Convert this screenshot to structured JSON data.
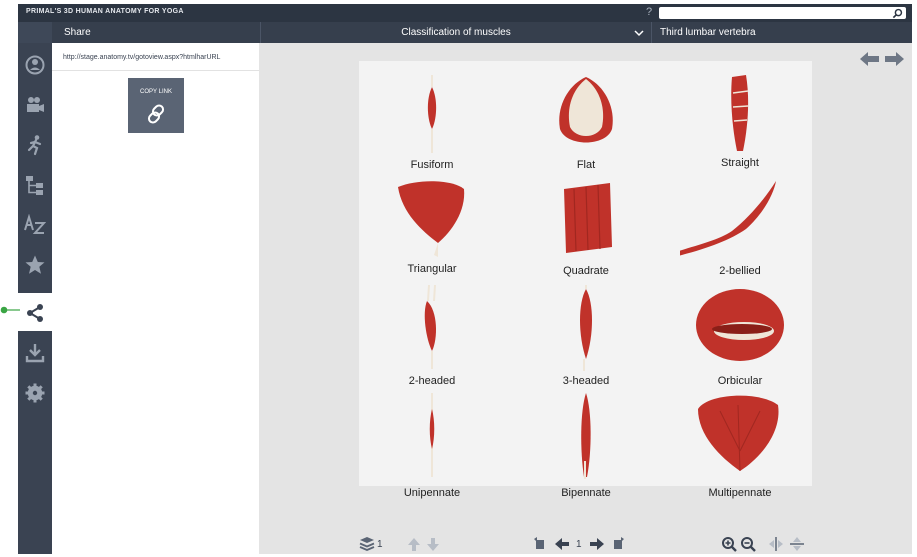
{
  "app": {
    "title": "PRIMAL'S 3D HUMAN ANATOMY FOR YOGA",
    "help": "?"
  },
  "search": {
    "placeholder": ""
  },
  "header": {
    "share": "Share",
    "classification": "Classification of muscles",
    "lumbar": "Third lumbar vertebra"
  },
  "sidebar": {
    "items": [
      {
        "icon": "atlas-icon"
      },
      {
        "icon": "video-camera-icon"
      },
      {
        "icon": "running-figure-icon"
      },
      {
        "icon": "hierarchy-tree-icon"
      },
      {
        "icon": "a-to-z-icon"
      },
      {
        "icon": "star-icon"
      },
      {
        "icon": "share-icon",
        "active": true
      },
      {
        "icon": "download-icon"
      },
      {
        "icon": "settings-gear-icon"
      }
    ]
  },
  "share_panel": {
    "url": "http://stage.anatomy.tv/gotoview.aspx?htmlharURL",
    "copy_link": "COPY LINK"
  },
  "muscles": [
    {
      "label": "Fusiform"
    },
    {
      "label": "Flat"
    },
    {
      "label": "Straight"
    },
    {
      "label": "Triangular"
    },
    {
      "label": "Quadrate"
    },
    {
      "label": "2-bellied"
    },
    {
      "label": "2-headed"
    },
    {
      "label": "3-headed"
    },
    {
      "label": "Orbicular"
    },
    {
      "label": "Unipennate"
    },
    {
      "label": "Bipennate"
    },
    {
      "label": "Multipennate"
    }
  ],
  "toolbar": {
    "layer_count": "1",
    "page_number": "1"
  },
  "colors": {
    "titlebar": "#2c3542",
    "header": "#363f4d",
    "sidebar": "#3a4352",
    "muscle": "#c0322a",
    "tendon": "#efe6d8",
    "connector": "#3aa544"
  }
}
